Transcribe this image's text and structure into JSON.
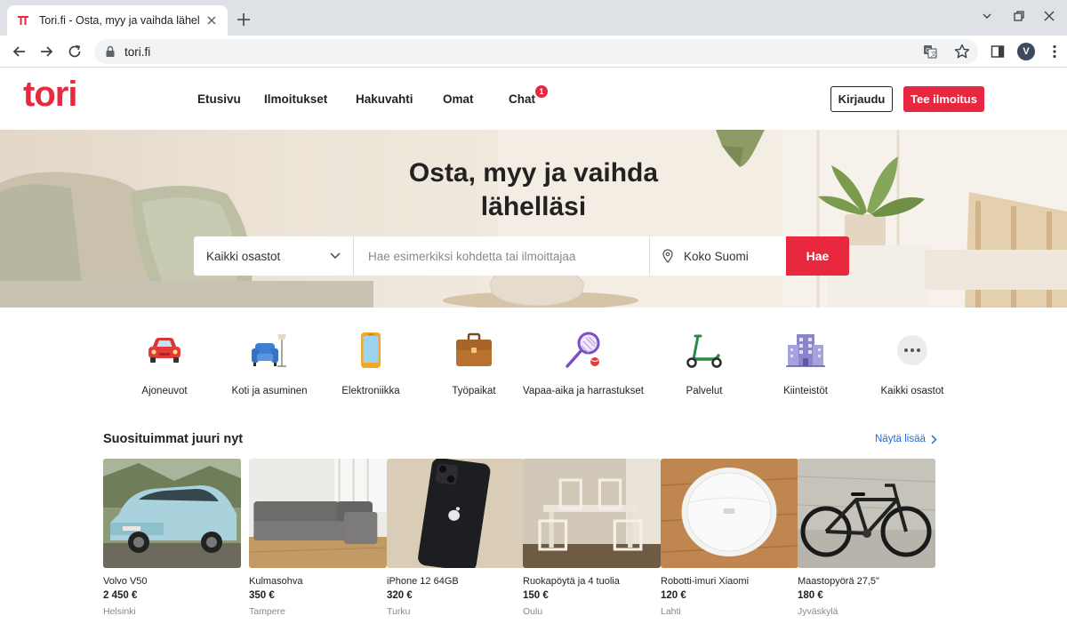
{
  "browser": {
    "tab_title": "Tori.fi - Osta, myy ja vaihda lähelläsi",
    "url": "tori.fi",
    "profile_initial": "V"
  },
  "header": {
    "logo": "tori",
    "nav": [
      {
        "label": "Etusivu"
      },
      {
        "label": "Ilmoitukset"
      },
      {
        "label": "Hakuvahti"
      },
      {
        "label": "Omat"
      },
      {
        "label": "Chat",
        "badge": "1"
      }
    ],
    "login_label": "Kirjaudu",
    "post_label": "Tee ilmoitus"
  },
  "hero": {
    "title_line1": "Osta, myy ja vaihda",
    "title_line2": "lähelläsi",
    "category_select": "Kaikki osastot",
    "search_placeholder": "Hae esimerkiksi kohdetta tai ilmoittajaa",
    "location": "Koko Suomi",
    "search_button": "Hae"
  },
  "categories": [
    {
      "label": "Ajoneuvot",
      "icon": "car-icon"
    },
    {
      "label": "Koti ja asuminen",
      "icon": "armchair-lamp-icon"
    },
    {
      "label": "Elektroniikka",
      "icon": "phone-icon"
    },
    {
      "label": "Työpaikat",
      "icon": "briefcase-icon"
    },
    {
      "label": "Vapaa-aika ja harrastukset",
      "icon": "tennis-racket-icon"
    },
    {
      "label": "Palvelut",
      "icon": "scooter-icon"
    },
    {
      "label": "Kiinteistöt",
      "icon": "building-icon"
    },
    {
      "label": "Kaikki osastot",
      "icon": "more-dots-icon"
    }
  ],
  "popular": {
    "title": "Suosituimmat juuri nyt",
    "see_more": "Näytä lisää",
    "items": [
      {
        "title": "Volvo V50",
        "price": "2 450 €",
        "location": "Helsinki"
      },
      {
        "title": "Kulmasohva",
        "price": "350 €",
        "location": "Tampere"
      },
      {
        "title": "iPhone 12 64GB",
        "price": "320 €",
        "location": "Turku"
      },
      {
        "title": "Ruokapöytä ja 4 tuolia",
        "price": "150 €",
        "location": "Oulu"
      },
      {
        "title": "Robotti-imuri Xiaomi",
        "price": "120 €",
        "location": "Lahti"
      },
      {
        "title": "Maastopyörä 27,5\"",
        "price": "180 €",
        "location": "Jyväskylä"
      }
    ]
  },
  "colors": {
    "brand": "#e8283e",
    "link": "#1a6ed8"
  }
}
